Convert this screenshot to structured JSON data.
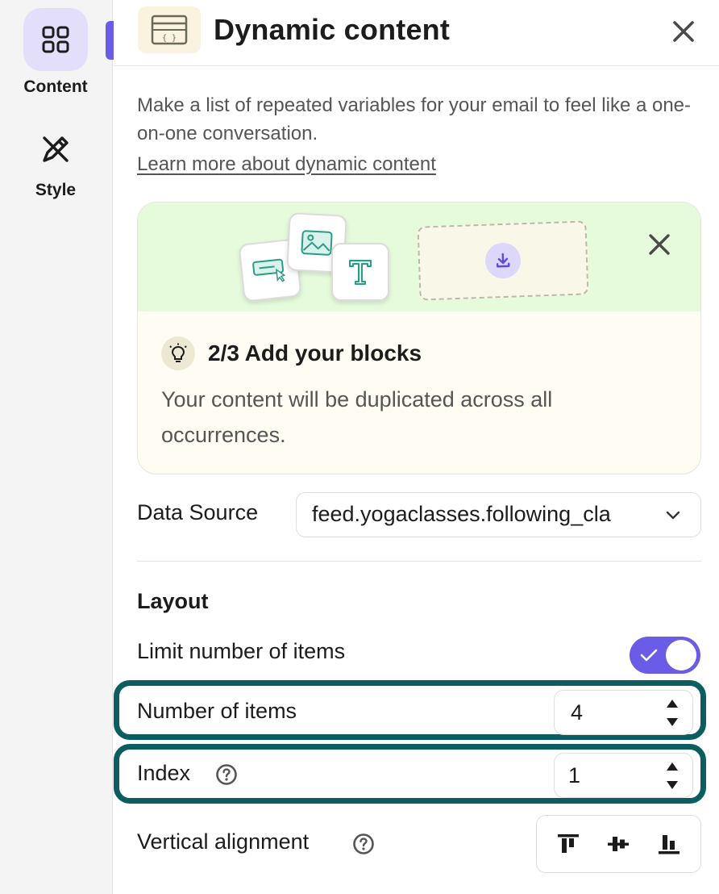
{
  "rail": {
    "items": [
      {
        "label": "Content",
        "icon": "grid-icon",
        "active": true
      },
      {
        "label": "Style",
        "icon": "pen-icon",
        "active": false
      }
    ],
    "accent_color": "#6b5ce7"
  },
  "panel": {
    "title": "Dynamic content",
    "description": "Make a list of repeated variables for your email to feel like a one-on-one conversation.",
    "learn_more_link": "Learn more about dynamic content",
    "onboarding": {
      "step": "2/3 Add your blocks",
      "text": "Your content will be duplicated across all occurrences.",
      "tiles": [
        "button-block-icon",
        "image-block-icon",
        "text-block-icon"
      ]
    },
    "data_source": {
      "label": "Data Source",
      "value": "feed.yogaclasses.following_cla"
    },
    "layout": {
      "title": "Layout",
      "limit_items": {
        "label": "Limit number of items",
        "enabled": true
      },
      "number_of_items": {
        "label": "Number of items",
        "value": "4"
      },
      "index": {
        "label": "Index",
        "value": "1"
      },
      "vertical_alignment": {
        "label": "Vertical alignment",
        "options": [
          "align-top-icon",
          "align-middle-icon",
          "align-bottom-icon"
        ]
      }
    },
    "highlight_color": "#0c5d60"
  }
}
